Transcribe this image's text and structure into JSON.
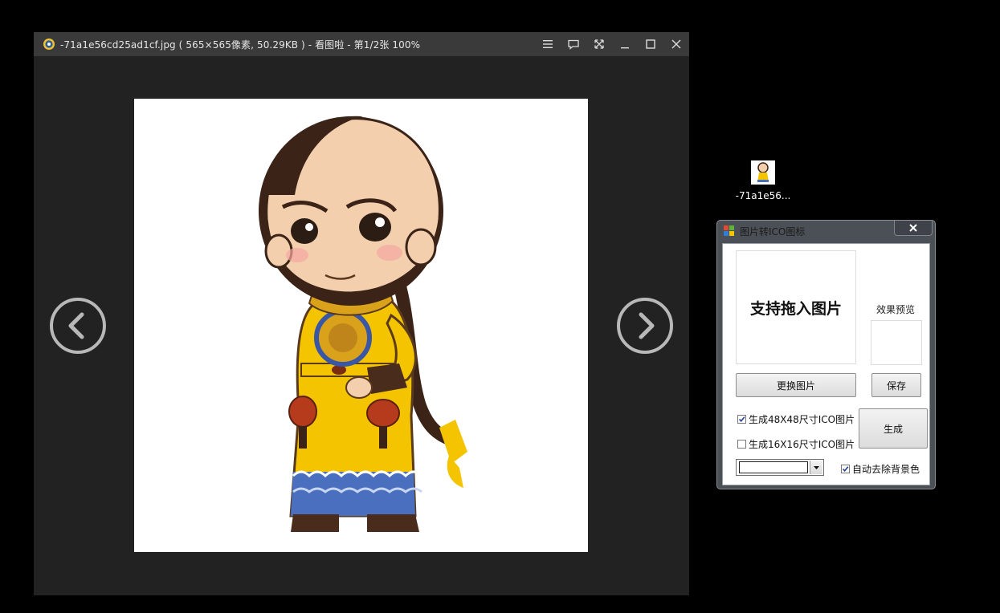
{
  "viewer": {
    "title": "-71a1e56cd25ad1cf.jpg ( 565×565像素, 50.29KB ) - 看图啦 - 第1/2张 100%",
    "icons": [
      "menu-icon",
      "comment-icon",
      "fullscreen-icon",
      "minimize-icon",
      "maximize-icon",
      "close-icon"
    ],
    "nav": {
      "prev_icon": "chevron-left-icon",
      "next_icon": "chevron-right-icon"
    }
  },
  "desktop": {
    "file_label": "-71a1e56..."
  },
  "dialog": {
    "title": "图片转ICO图标",
    "drop_text": "支持拖入图片",
    "preview_label": "效果预览",
    "change_button": "更换图片",
    "save_button": "保存",
    "generate_button": "生成",
    "option_48": {
      "label": "生成48X48尺寸ICO图片",
      "checked": true
    },
    "option_16": {
      "label": "生成16X16尺寸ICO图片",
      "checked": false
    },
    "remove_bg": {
      "label": "自动去除背景色",
      "checked": true
    },
    "color_select_value": ""
  },
  "colors": {
    "desktop_bg": "#000000",
    "viewer_bg": "#222222",
    "viewer_titlebar": "#3a3a3a",
    "dialog_frame": "#4b4f56",
    "robe_yellow": "#f5c400"
  }
}
